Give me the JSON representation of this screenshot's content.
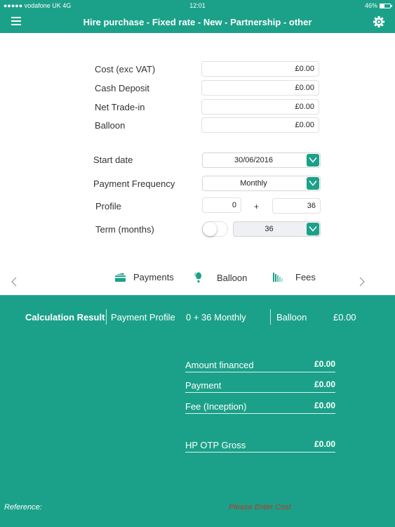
{
  "status_bar": {
    "carrier": "●●●●● vodafone UK   4G",
    "time": "12:01",
    "battery": "46%"
  },
  "nav": {
    "title": "Hire purchase - Fixed rate - New - Partnership - other",
    "menu_icon": "hamburger-menu-icon",
    "settings_icon": "gear-icon"
  },
  "form": {
    "cost_label": "Cost (exc VAT)",
    "cost_value": "£0.00",
    "deposit_label": "Cash Deposit",
    "deposit_value": "£0.00",
    "tradein_label": "Net Trade-in",
    "tradein_value": "£0.00",
    "balloon_label": "Balloon",
    "balloon_value": "£0.00",
    "start_date_label": "Start date",
    "start_date_value": "30/06/2016",
    "frequency_label": "Payment Frequency",
    "frequency_value": "Monthly",
    "profile_label": "Profile",
    "profile_upfront": "0",
    "profile_plus": "+",
    "profile_regular": "36",
    "term_label": "Term (months)",
    "term_toggle_on": false,
    "term_value": "36"
  },
  "tabs": [
    {
      "label": "Payments",
      "icon": "credit-card-icon"
    },
    {
      "label": "Balloon",
      "icon": "balloon-icon"
    },
    {
      "label": "Fees",
      "icon": "fees-bars-icon"
    }
  ],
  "results": {
    "header": {
      "title": "Calculation Result",
      "profile_label": "Payment Profile",
      "profile_value": "0 + 36 Monthly",
      "balloon_label": "Balloon",
      "balloon_value": "£0.00"
    },
    "rows": [
      {
        "label": "Amount financed",
        "value": "£0.00"
      },
      {
        "label": "Payment",
        "value": "£0.00"
      },
      {
        "label": "Fee (Inception)",
        "value": "£0.00"
      },
      {
        "label": "HP OTP Gross",
        "value": "£0.00"
      }
    ],
    "reference_label": "Reference:",
    "message": "Please Enter Cost"
  },
  "colors": {
    "brand": "#1ba189",
    "error": "#b83a2b"
  }
}
